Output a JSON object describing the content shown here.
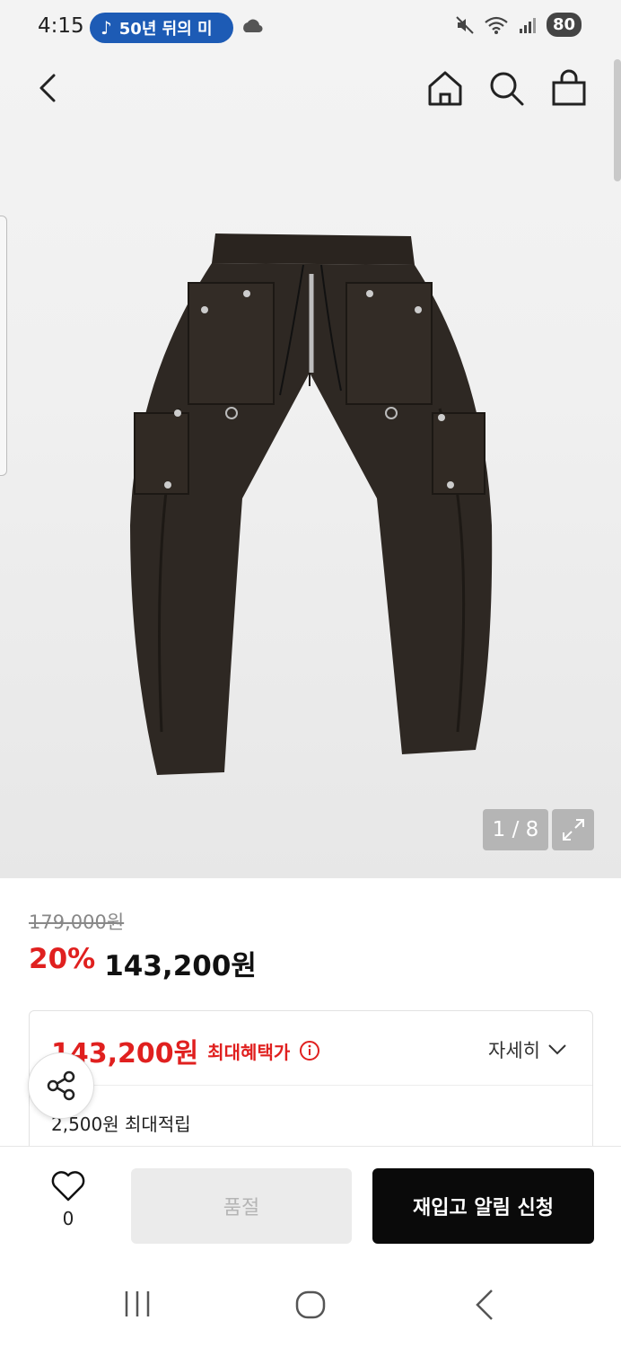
{
  "status_bar": {
    "time": "4:15",
    "music_text": "50년 뒤의 미",
    "battery": "80"
  },
  "gallery": {
    "page_counter": "1 / 8"
  },
  "price": {
    "original": "179,000원",
    "discount_rate": "20%",
    "sale": "143,200원"
  },
  "benefit": {
    "max_price": "143,200원",
    "max_label": "최대혜택가",
    "detail_label": "자세히",
    "points": "2,500원 최대적립"
  },
  "actions": {
    "like_count": "0",
    "soldout_label": "품절",
    "restock_label": "재입고 알림 신청"
  },
  "colors": {
    "accent_red": "#e0201f",
    "music_pill": "#1d5bb5"
  }
}
